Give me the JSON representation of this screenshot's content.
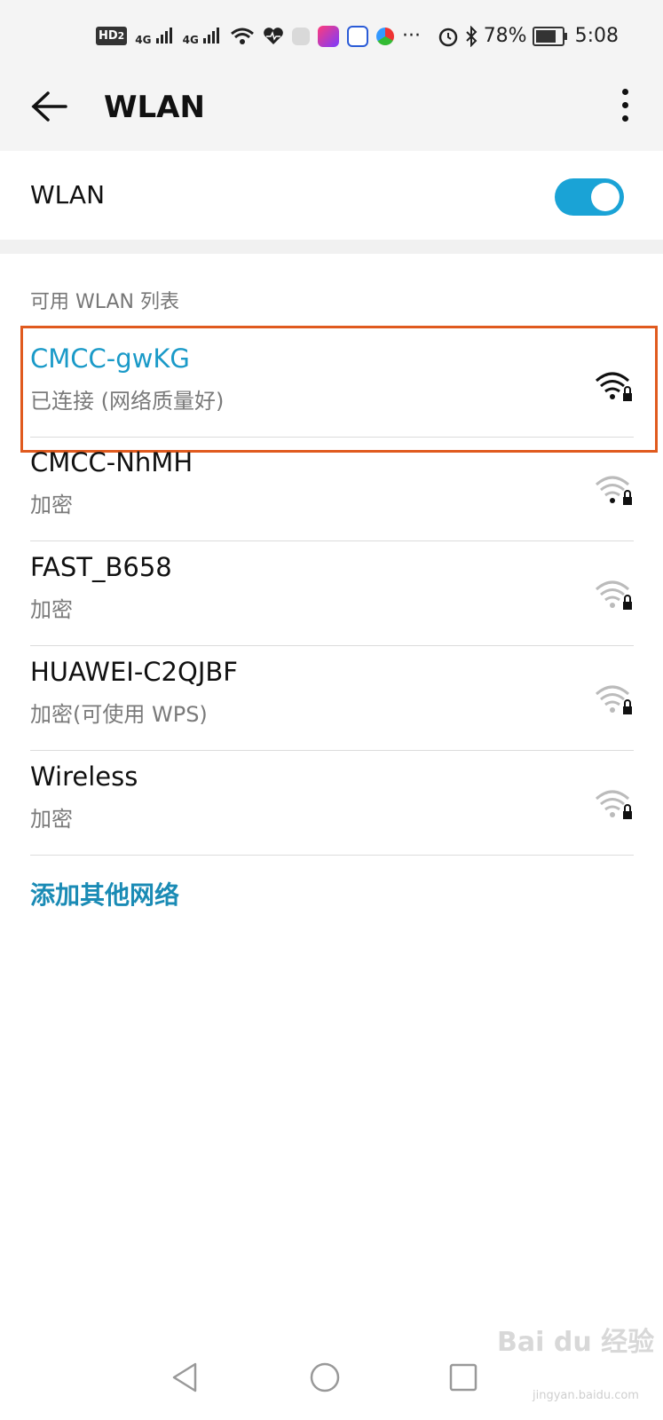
{
  "status_bar": {
    "hd_label": "HD",
    "hd_sub": "2",
    "net1": "4G",
    "net2": "4G",
    "more": "···",
    "battery_percent": "78%",
    "battery_level": 0.78,
    "time": "5:08",
    "icons": [
      "hd-icon",
      "signal-icon",
      "signal-icon",
      "wifi-icon",
      "health-icon",
      "puzzle-icon",
      "app-icon",
      "baidu-icon",
      "browser-icon",
      "alarm-icon",
      "bluetooth-icon",
      "battery-icon"
    ]
  },
  "appbar": {
    "title": "WLAN"
  },
  "wlan_toggle": {
    "label": "WLAN",
    "on": true,
    "accent": "#1aa3d6"
  },
  "section_title": "可用 WLAN 列表",
  "networks": [
    {
      "ssid": "CMCC-gwKG",
      "status": "已连接 (网络质量好)",
      "connected": true
    },
    {
      "ssid": "CMCC-NhMH",
      "status": "加密",
      "connected": false
    },
    {
      "ssid": "FAST_B658",
      "status": "加密",
      "connected": false
    },
    {
      "ssid": "HUAWEI-C2QJBF",
      "status": "加密(可使用 WPS)",
      "connected": false
    },
    {
      "ssid": "Wireless",
      "status": "加密",
      "connected": false
    }
  ],
  "add_network": "添加其他网络",
  "highlight_color": "#e05a1e",
  "watermark": {
    "main": "Bai du 经验",
    "sub": "jingyan.baidu.com"
  }
}
